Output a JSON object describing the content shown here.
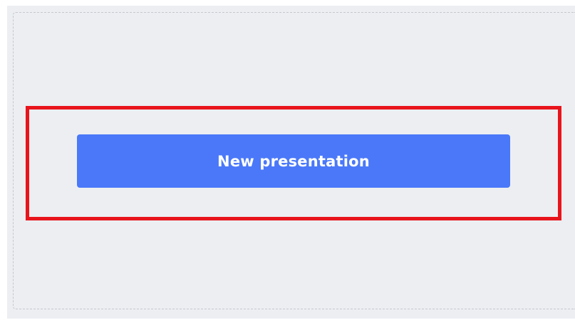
{
  "new_presentation": {
    "label": "New presentation"
  },
  "colors": {
    "panel_background": "#eceef2",
    "button_background": "#4a78f9",
    "button_text": "#ffffff",
    "highlight_border": "#e8141c",
    "dashed_border": "#c4c7cf"
  }
}
